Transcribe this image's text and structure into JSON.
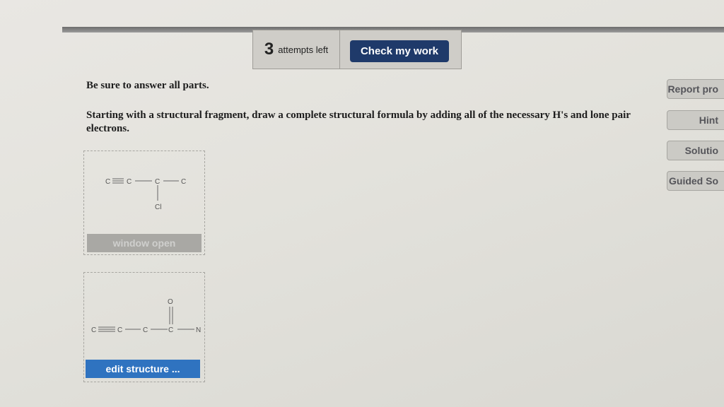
{
  "toolbar": {
    "attempts_count": "3",
    "attempts_label": "attempts left",
    "check_label": "Check my work"
  },
  "content": {
    "instruction": "Be sure to answer all parts.",
    "question": "Starting with a structural fragment, draw a complete structural formula by adding all of the necessary H's and lone pair electrons."
  },
  "sidebar": {
    "buttons": [
      {
        "label": "Report pro"
      },
      {
        "label": "Hint"
      },
      {
        "label": "Solutio"
      },
      {
        "label": "Guided So"
      }
    ]
  },
  "panels": [
    {
      "button_label": "window open",
      "atoms": {
        "c1": "C",
        "c2": "C",
        "c3": "C",
        "c4": "C",
        "cl": "Cl"
      }
    },
    {
      "button_label": "edit structure ...",
      "atoms": {
        "c1": "C",
        "c2": "C",
        "c3": "C",
        "c4": "C",
        "n": "N",
        "o": "O"
      }
    }
  ],
  "colors": {
    "check_button": "#1f3a6a",
    "edit_button": "#2f73c0",
    "window_button": "#a9a8a4"
  }
}
